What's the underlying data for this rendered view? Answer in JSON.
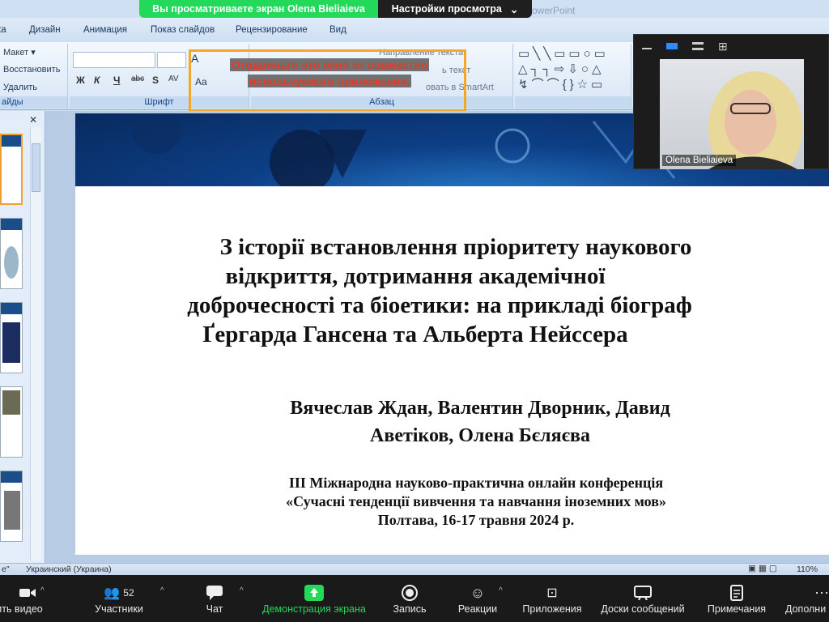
{
  "zoom_banner": {
    "viewing_text": "Вы просматриваете экран Olena Bieliaieva",
    "view_settings": "Настройки просмотра",
    "app_title_fragment": "owerPoint"
  },
  "ribbon": {
    "tabs": [
      "ка",
      "Дизайн",
      "Анимация",
      "Показ слайдов",
      "Рецензирование",
      "Вид"
    ],
    "slides_group": {
      "layout": "Макет",
      "reset": "Восстановить",
      "delete": "Удалить",
      "name": "айды"
    },
    "font_group": {
      "name": "Шрифт",
      "grow": "A",
      "shrink": "A",
      "case": "Aa"
    },
    "paragraph_group": {
      "name": "Абзац",
      "text_direction": "Направление текста",
      "align_text": "ь текст",
      "smartart": "овать в SmartArt"
    },
    "format_buttons": [
      "Ж",
      "К",
      "Ч",
      "abc",
      "S",
      "AV"
    ]
  },
  "overlay_warning": {
    "line1": "Отодвиньте это окно от совместно",
    "line2": "используемого приложения."
  },
  "slide": {
    "title_lines": [
      "З історії встановлення пріоритету наукового",
      "відкриття, дотримання академічної",
      "доброчесності  та біоетики: на прикладі біограф",
      "Ґергарда Гансена та Альберта Нейссера"
    ],
    "authors_lines": [
      "Вячеслав  Ждан, Валентин Дворник, Давид",
      "Аветіков, Олена Бєляєва"
    ],
    "conference_lines": [
      "ІІІ Міжнародна науково-практична онлайн конференція",
      "«Сучасні тенденції вивчення та навчання іноземних мов»",
      "Полтава, 16-17 травня 2024 р."
    ]
  },
  "statusbar": {
    "left_fragment": "е\"",
    "language": "Украинский (Украина)",
    "zoom_level": "110%"
  },
  "video": {
    "participant_name": "Olena Bieliaieva"
  },
  "toolbar": {
    "video": "ить видео",
    "participants": "Участники",
    "participants_count": "52",
    "chat": "Чат",
    "share_screen": "Демонстрация экрана",
    "record": "Запись",
    "reactions": "Реакции",
    "apps": "Приложения",
    "whiteboards": "Доски сообщений",
    "notes": "Примечания",
    "more": "Дополни"
  },
  "colors": {
    "share_green": "#23d95a",
    "warning_orange": "#f5a623",
    "warning_text": "#e23b2a",
    "toolbar_bg": "#1a1a1a"
  }
}
